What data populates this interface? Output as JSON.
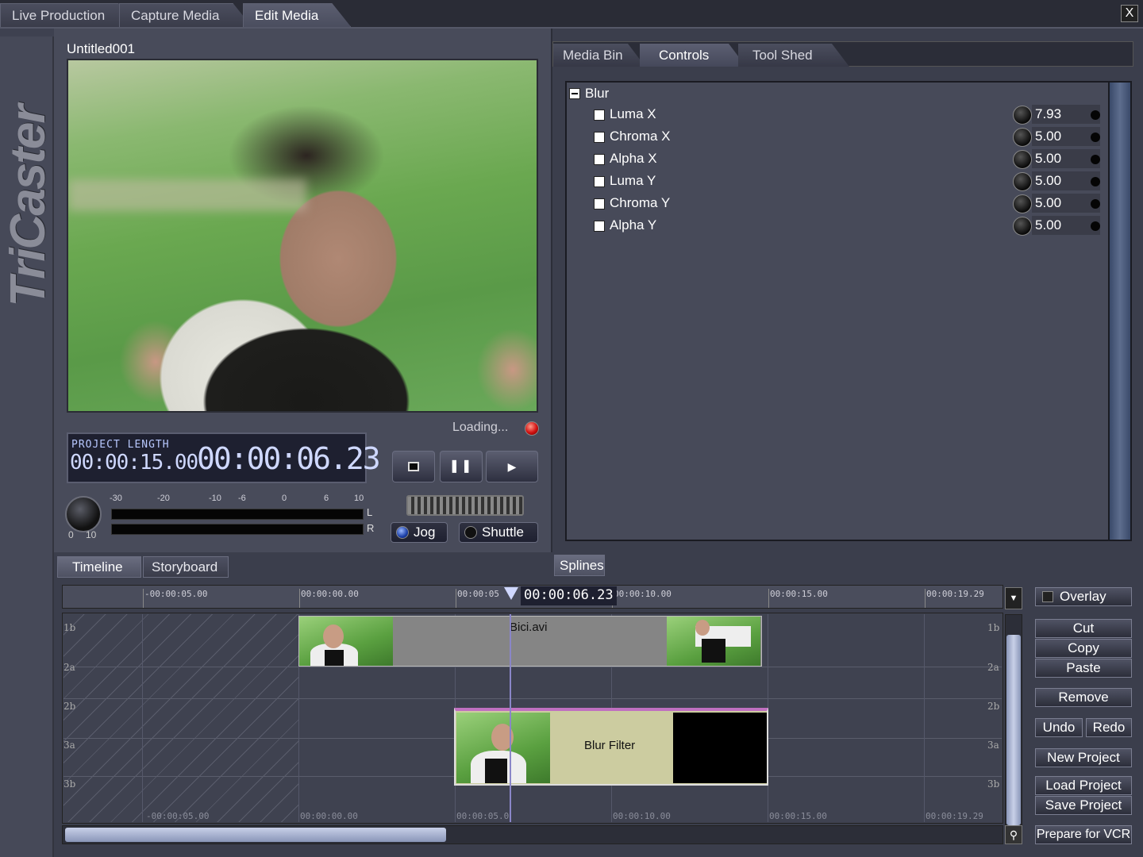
{
  "top_tabs": [
    "Live Production",
    "Capture Media",
    "Edit Media"
  ],
  "close_label": "X",
  "logo": "TriCaster",
  "preview": {
    "project_title": "Untitled001",
    "loading_text": "Loading...",
    "project_length_label": "PROJECT LENGTH",
    "project_length": "00:00:15.00",
    "current_timecode": "00:00:06.23",
    "knob_min": "0",
    "knob_max": "10",
    "vu_ticks": [
      "-30",
      "-20",
      "-10",
      "-6",
      "0",
      "6",
      "10"
    ],
    "vu_left": "L",
    "vu_right": "R",
    "jog_label": "Jog",
    "shuttle_label": "Shuttle"
  },
  "right_tabs": [
    "Media Bin",
    "Controls",
    "Tool Shed"
  ],
  "controls": {
    "group": "Blur",
    "params": [
      {
        "name": "Luma X",
        "value": "7.93"
      },
      {
        "name": "Chroma X",
        "value": "5.00"
      },
      {
        "name": "Alpha X",
        "value": "5.00"
      },
      {
        "name": "Luma Y",
        "value": "5.00"
      },
      {
        "name": "Chroma Y",
        "value": "5.00"
      },
      {
        "name": "Alpha Y",
        "value": "5.00"
      }
    ]
  },
  "bottom_tabs": [
    "Timeline",
    "Storyboard"
  ],
  "splines_tab": "Splines",
  "timeline": {
    "ruler_ticks": [
      "-00:00:05.00",
      "00:00:00.00",
      "00:00:05",
      "00:00:10.00",
      "00:00:15.00",
      "00:00:19.29"
    ],
    "playhead": "00:00:06.23",
    "bottom_ticks": [
      "-00:00:05.00",
      "00:00:00.00",
      "00:00:05.0",
      "00:00:10.00",
      "00:00:15.00",
      "00:00:19.29"
    ],
    "track_labels": [
      "1b",
      "2a",
      "2b",
      "3a",
      "3b"
    ],
    "clip_video": "Bici.avi",
    "clip_filter": "Blur Filter"
  },
  "actions": {
    "overlay": "Overlay",
    "cut": "Cut",
    "copy": "Copy",
    "paste": "Paste",
    "remove": "Remove",
    "undo": "Undo",
    "redo": "Redo",
    "new_project": "New Project",
    "load_project": "Load Project",
    "save_project": "Save Project",
    "prepare_vcr": "Prepare for VCR"
  }
}
